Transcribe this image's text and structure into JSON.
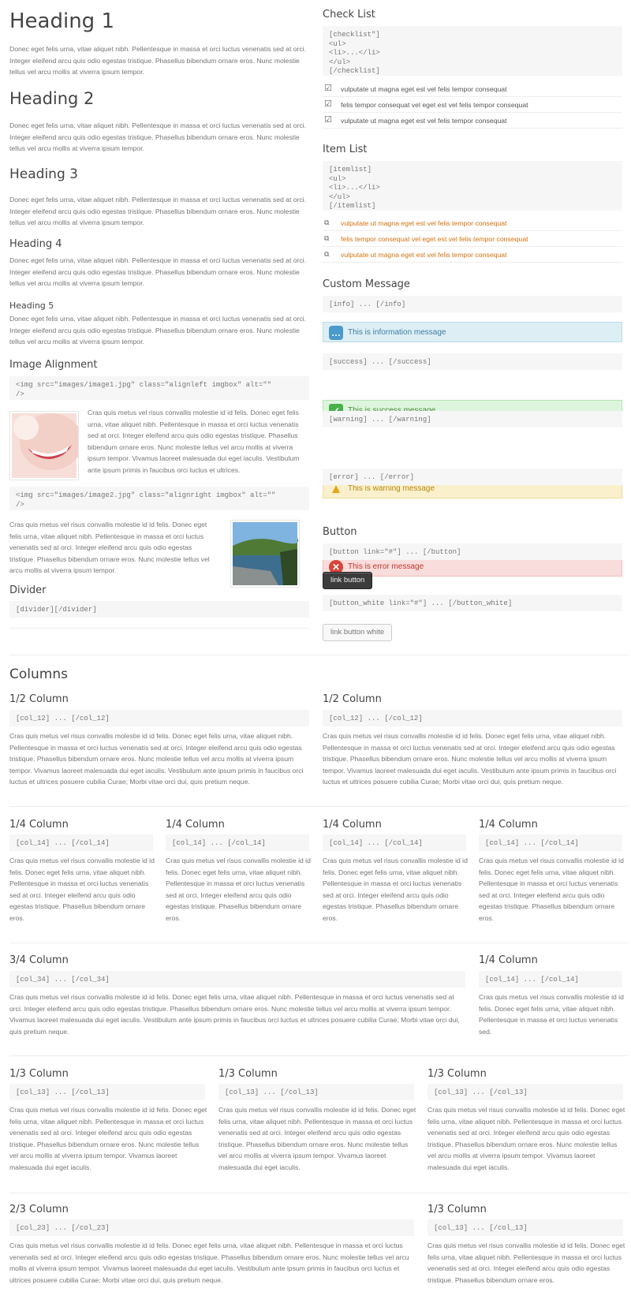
{
  "lorem_short": "Donec eget felis urna, vitae aliquet nibh. Pellentesque in massa et orci luctus venenatis sed at orci. Integer eleifend arcu quis odio egestas tristique. Phasellus bibendum ornare eros. Nunc molestie tellus vel arcu mollis at viverra ipsum tempor.",
  "headings": [
    "Heading 1",
    "Heading 2",
    "Heading 3",
    "Heading 4",
    "Heading 5"
  ],
  "image_alignment": {
    "title": "Image Alignment",
    "code_left": "<img src=\"images/image1.jpg\" class=\"alignleft imgbox\" alt=\"\"\n/>",
    "text_left": "Cras quis metus vel risus convallis molestie id id felis. Donec eget felis urna, vitae aliquet nibh. Pellentesque in massa et orci luctus venenatis sed at orci. Integer eleifend arcu quis odio egestas tristique. Phasellus bibendum ornare eros. Nunc molestie tellus vel arcu mollis at viverra ipsum tempor. Vivamus laoreet malesuada dui eget iaculis. Vestibulum ante ipsum primis in faucibus orci luctus et ultrices.",
    "code_right": "<img src=\"images/image2.jpg\" class=\"alignright imgbox\" alt=\"\"\n/>",
    "text_right": "Cras quis metus vel risus convallis molestie id id felis. Donec eget felis urna, vitae aliquet nibh. Pellentesque in massa et orci luctus venenatis sed at orci. Integer eleifend arcu quis odio egestas tristique. Phasellus bibendum ornare eros. Nunc molestie tellus vel arcu mollis at viverra ipsum tempor."
  },
  "divider": {
    "title": "Divider",
    "code": "[divider][/divider]"
  },
  "checklist": {
    "title": "Check List",
    "code": "[checklist\"]\n<ul>\n<li>...</li>\n</ul>\n[/checklist]",
    "items": [
      "vulputate ut magna eget est vel felis tempor consequat",
      "felis tempor consequat vel eget est vel felis tempor consequat",
      "vulputate ut magna eget est vel felis tempor consequat"
    ]
  },
  "itemlist": {
    "title": "Item List",
    "code": "[itemlist]\n<ul>\n<li>...</li>\n</ul>\n[/itemlist]",
    "items": [
      "vulputate ut magna eget est vel felis tempor consequat",
      "felis tempor consequat vel eget est vel felis tempor consequat",
      "vulputate ut magna eget est vel felis tempor consequat"
    ]
  },
  "messages": {
    "title": "Custom Message",
    "info_code": "[info] ... [/info]",
    "info": "This is information message",
    "success_code": "[success] ... [/success]",
    "success": "This is success message",
    "warning_code": "[warning] ... [/warning]",
    "warning": "This is warning message",
    "error_code": "[error] ... [/error]",
    "error": "This is error message"
  },
  "button": {
    "title": "Button",
    "code": "[button link=\"#\"] ... [/button]",
    "label": "link button",
    "white_code": "[button_white link=\"#\"] ... [/button_white]",
    "white_label": "link button white"
  },
  "columns": {
    "title": "Columns",
    "lorem_half": "Cras quis metus vel risus convallis molestie id id felis. Donec eget felis urna, vitae aliquet nibh. Pellentesque in massa et orci luctus venenatis sed at orci. Integer eleifend arcu quis odio egestas tristique. Phasellus bibendum ornare eros. Nunc molestie tellus vel arcu mollis at viverra ipsum tempor. Vivamus laoreet malesuada dui eget iaculis. Vestibulum ante ipsum primis in faucibus orci luctus et ultrices posuere cubilia Curae; Morbi vitae orci dui, quis pretium neque.",
    "lorem_quarter": "Cras quis metus vel risus convallis molestie id id felis. Donec eget felis urna, vitae aliquet nibh. Pellentesque in massa et orci luctus venenatis sed at orci. Integer eleifend arcu quis odio egestas tristique. Phasellus bibendum ornare eros.",
    "lorem_threequarter": "Cras quis metus vel risus convallis molestie id id felis. Donec eget felis urna, vitae aliquet nibh. Pellentesque in massa et orci luctus venenatis sed at orci. Integer eleifend arcu quis odio egestas tristique. Phasellus bibendum ornare eros. Nunc molestie tellus vel arcu mollis at viverra ipsum tempor. Vivamus laoreet malesuada dui eget iaculis. Vestibulum ante ipsum primis in faucibus orci luctus et ultrices posuere cubilia Curae; Morbi vitae orci dui, quis pretium neque.",
    "lorem_quarter_short": "Cras quis metus vel risus convallis molestie id id felis. Donec eget felis urna, vitae aliquet nibh. Pellentesque in massa et orci luctus venenatis sed.",
    "lorem_third": "Cras quis metus vel risus convallis molestie id id felis. Donec eget felis urna, vitae aliquet nibh. Pellentesque in massa et orci luctus venenatis sed at orci. Integer eleifend arcu quis odio egestas tristique. Phasellus bibendum ornare eros. Nunc molestie tellus vel arcu mollis at viverra ipsum tempor. Vivamus laoreet malesuada dui eget iaculis.",
    "lorem_twothird": "Cras quis metus vel risus convallis molestie id id felis. Donec eget felis urna, vitae aliquet nibh. Pellentesque in massa et orci luctus venenatis sed at orci. Integer eleifend arcu quis odio egestas tristique. Phasellus bibendum ornare eros. Nunc molestie tellus vel arcu mollis at viverra ipsum tempor. Vivamus laoreet malesuada dui eget iaculis. Vestibulum ante ipsum primis in faucibus orci luctus et ultrices posuere cubilia Curae; Morbi vitae orci dui, quis pretium neque.",
    "lorem_third_short": "Cras quis metus vel risus convallis molestie id id felis. Donec eget felis urna, vitae aliquet nibh. Pellentesque in massa et orci luctus venenatis sed at orci. Integer eleifend arcu quis odio egestas tristique. Phasellus bibendum ornare eros.",
    "half_title": "1/2 Column",
    "half_code": "[col_12] ... [/col_12]",
    "quarter_title": "1/4 Column",
    "quarter_code": "[col_14] ... [/col_14]",
    "threequarter_title": "3/4 Column",
    "threequarter_code": "[col_34] ... [/col_34]",
    "third_title": "1/3 Column",
    "third_code": "[col_13] ... [/col_13]",
    "twothird_title": "2/3 Column",
    "twothird_code": "[col_23] ... [/col_23]"
  },
  "colors": {
    "info_bg": "#ddeef5",
    "success_bg": "#ddf5dd",
    "warning_bg": "#fbf0cc",
    "error_bg": "#f9dcdc",
    "itemlist_link": "#d4720f"
  }
}
